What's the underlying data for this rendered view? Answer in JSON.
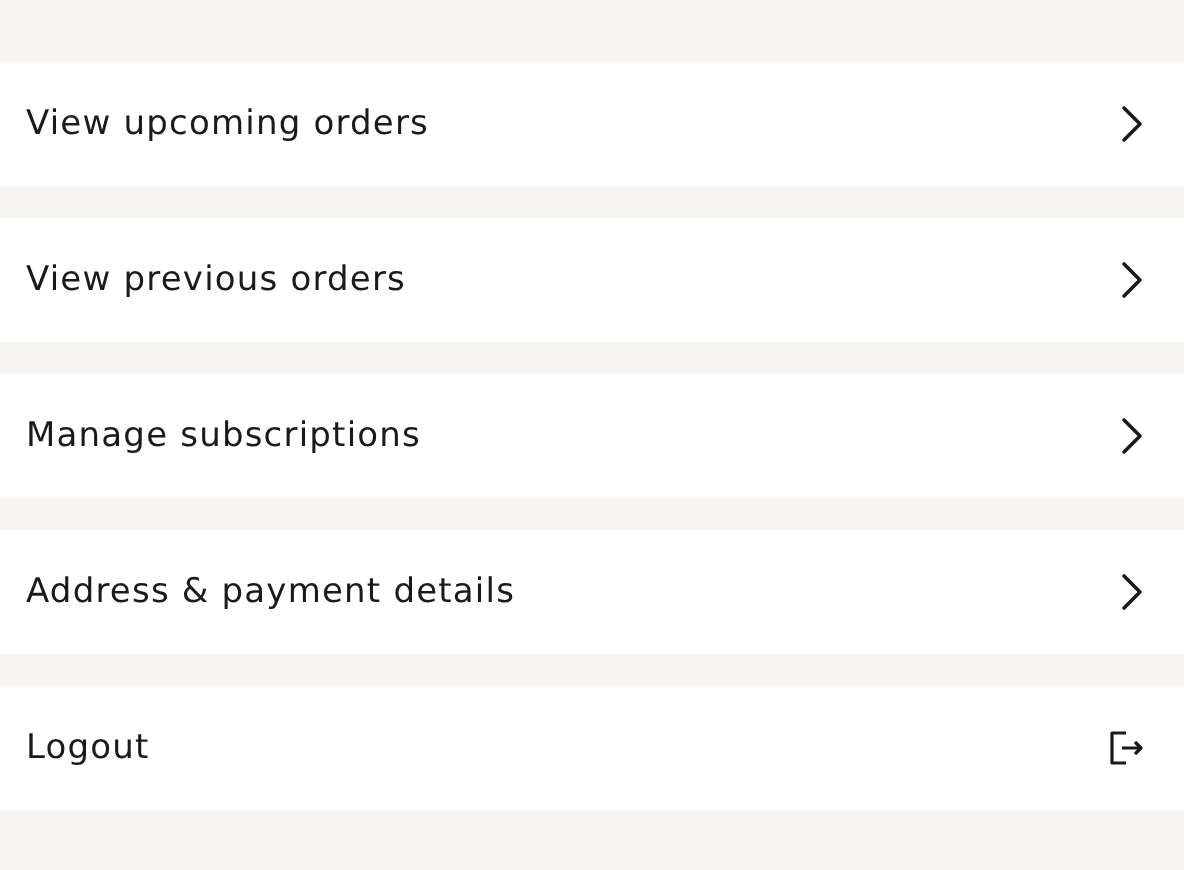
{
  "menu_items": [
    {
      "label": "View upcoming orders",
      "kind": "link"
    },
    {
      "label": "View previous orders",
      "kind": "link"
    },
    {
      "label": "Manage subscriptions",
      "kind": "link"
    },
    {
      "label": "Address & payment details",
      "kind": "link"
    },
    {
      "label": "Logout",
      "kind": "logout"
    }
  ]
}
